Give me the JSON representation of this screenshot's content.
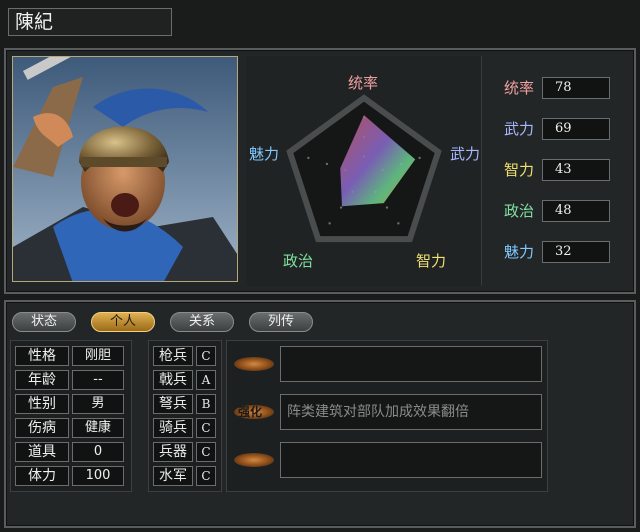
{
  "general": {
    "name": "陳紀"
  },
  "colors": {
    "tong": "#f0a0a0",
    "wu": "#a8b8ff",
    "zhi": "#f0e070",
    "zheng": "#80e0a0",
    "mei": "#80c8ff",
    "tab_active": "#e0b050"
  },
  "radar": {
    "labels": {
      "tong": "统率",
      "wu": "武力",
      "zhi": "智力",
      "zheng": "政治",
      "mei": "魅力"
    },
    "max": 100
  },
  "stats": [
    {
      "label": "统率",
      "value": "78",
      "num": 78
    },
    {
      "label": "武力",
      "value": "69",
      "num": 69
    },
    {
      "label": "智力",
      "value": "43",
      "num": 43
    },
    {
      "label": "政治",
      "value": "48",
      "num": 48
    },
    {
      "label": "魅力",
      "value": "32",
      "num": 32
    }
  ],
  "tabs": [
    {
      "label": "状态",
      "active": false
    },
    {
      "label": "个人",
      "active": true
    },
    {
      "label": "关系",
      "active": false
    },
    {
      "label": "列传",
      "active": false
    }
  ],
  "personal": [
    {
      "label": "性格",
      "value": "刚胆"
    },
    {
      "label": "年龄",
      "value": "--"
    },
    {
      "label": "性别",
      "value": "男"
    },
    {
      "label": "伤病",
      "value": "健康"
    },
    {
      "label": "道具",
      "value": "0"
    },
    {
      "label": "体力",
      "value": "100"
    }
  ],
  "units": [
    {
      "label": "枪兵",
      "grade": "C"
    },
    {
      "label": "戟兵",
      "grade": "A"
    },
    {
      "label": "弩兵",
      "grade": "B"
    },
    {
      "label": "骑兵",
      "grade": "C"
    },
    {
      "label": "兵器",
      "grade": "C"
    },
    {
      "label": "水军",
      "grade": "C"
    }
  ],
  "skills": [
    {
      "icon": "skill-empty-icon",
      "name": "",
      "desc": ""
    },
    {
      "icon": "skill-reinforce-icon",
      "name": "强化",
      "desc": "阵类建筑对部队加成效果翻倍"
    },
    {
      "icon": "skill-empty-icon",
      "name": "",
      "desc": ""
    }
  ]
}
